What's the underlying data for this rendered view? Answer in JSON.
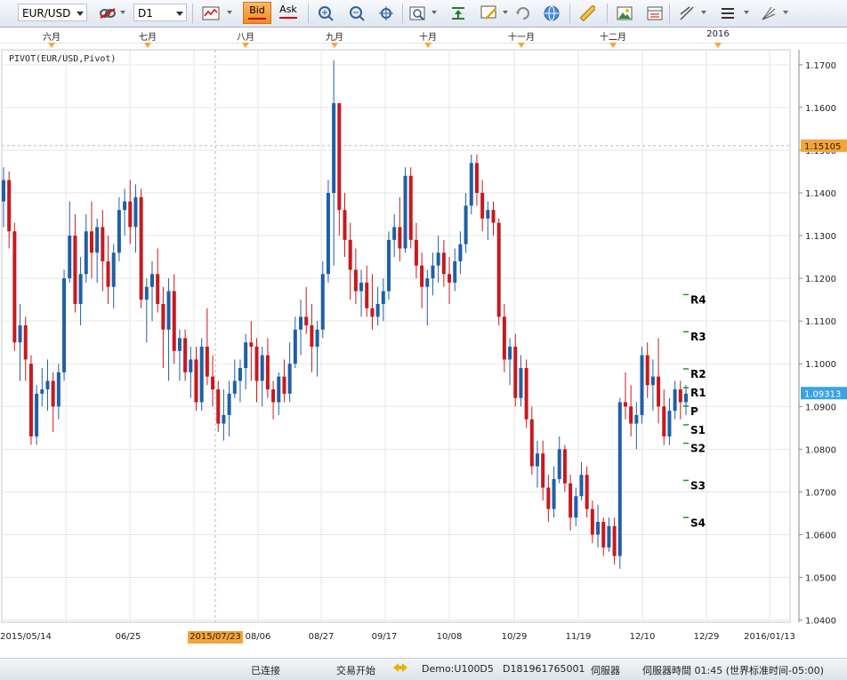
{
  "toolbar": {
    "symbol": "EUR/USD",
    "timeframe": "D1",
    "bid_label": "Bid",
    "ask_label": "Ask"
  },
  "indicator_label": "PIVOT(EUR/USD,Pivot)",
  "top_axis_months": [
    "六月",
    "七月",
    "八月",
    "九月",
    "十月",
    "十一月",
    "十二月",
    "2016"
  ],
  "bottom_axis_dates": [
    "2015/05/14",
    "06/25",
    "08/06",
    "08/27",
    "09/17",
    "10/08",
    "10/29",
    "11/19",
    "12/10",
    "12/29",
    "2016/01/13"
  ],
  "crosshair_date": "2015/07/23",
  "price_labels": [
    "1.1700",
    "1.1600",
    "1.1500",
    "1.1400",
    "1.1300",
    "1.1200",
    "1.1100",
    "1.1000",
    "1.0900",
    "1.0800",
    "1.0700",
    "1.0600",
    "1.0500",
    "1.0400"
  ],
  "crosshair_price": "1.15105",
  "current_price": "1.09313",
  "pivots": [
    {
      "label": "R4",
      "value": 1.1162
    },
    {
      "label": "R3",
      "value": 1.1075
    },
    {
      "label": "R2",
      "value": 1.0988
    },
    {
      "label": "R1",
      "value": 1.0944
    },
    {
      "label": "P",
      "value": 1.0901
    },
    {
      "label": "S1",
      "value": 1.0857
    },
    {
      "label": "S2",
      "value": 1.0814
    },
    {
      "label": "S3",
      "value": 1.0727
    },
    {
      "label": "S4",
      "value": 1.064
    }
  ],
  "status": {
    "connection": "已连接",
    "trading": "交易开始",
    "account": "Demo:U100D5",
    "login": "D181961765001",
    "server": "伺服器",
    "server_time": "伺服器時間 01:45 (世界标准时间-05:00)"
  },
  "colors": {
    "up": "#1f5fa8",
    "down": "#c8191e",
    "accent": "#f6a33a",
    "grid": "#e6e6e6"
  },
  "chart_data": {
    "type": "candlestick",
    "title": "",
    "yrange": [
      1.0395,
      1.1735
    ],
    "candles": [
      [
        1.138,
        1.146,
        1.132,
        1.143
      ],
      [
        1.143,
        1.145,
        1.127,
        1.131
      ],
      [
        1.131,
        1.133,
        1.103,
        1.105
      ],
      [
        1.105,
        1.114,
        1.096,
        1.109
      ],
      [
        1.109,
        1.111,
        1.096,
        1.101
      ],
      [
        1.1,
        1.102,
        1.081,
        1.083
      ],
      [
        1.083,
        1.095,
        1.081,
        1.093
      ],
      [
        1.093,
        1.099,
        1.09,
        1.094
      ],
      [
        1.094,
        1.101,
        1.089,
        1.096
      ],
      [
        1.096,
        1.098,
        1.084,
        1.09
      ],
      [
        1.09,
        1.1,
        1.087,
        1.098
      ],
      [
        1.098,
        1.122,
        1.096,
        1.12
      ],
      [
        1.12,
        1.138,
        1.119,
        1.13
      ],
      [
        1.13,
        1.135,
        1.112,
        1.114
      ],
      [
        1.114,
        1.125,
        1.109,
        1.121
      ],
      [
        1.121,
        1.135,
        1.119,
        1.131
      ],
      [
        1.131,
        1.138,
        1.12,
        1.126
      ],
      [
        1.126,
        1.134,
        1.119,
        1.132
      ],
      [
        1.132,
        1.136,
        1.117,
        1.124
      ],
      [
        1.124,
        1.13,
        1.114,
        1.118
      ],
      [
        1.118,
        1.128,
        1.113,
        1.126
      ],
      [
        1.126,
        1.139,
        1.124,
        1.136
      ],
      [
        1.136,
        1.141,
        1.13,
        1.138
      ],
      [
        1.138,
        1.143,
        1.128,
        1.132
      ],
      [
        1.132,
        1.142,
        1.126,
        1.139
      ],
      [
        1.139,
        1.141,
        1.113,
        1.115
      ],
      [
        1.115,
        1.12,
        1.105,
        1.118
      ],
      [
        1.118,
        1.124,
        1.11,
        1.121
      ],
      [
        1.121,
        1.127,
        1.112,
        1.114
      ],
      [
        1.114,
        1.118,
        1.099,
        1.108
      ],
      [
        1.108,
        1.12,
        1.096,
        1.117
      ],
      [
        1.117,
        1.121,
        1.1,
        1.103
      ],
      [
        1.103,
        1.108,
        1.096,
        1.106
      ],
      [
        1.106,
        1.108,
        1.096,
        1.098
      ],
      [
        1.098,
        1.104,
        1.092,
        1.101
      ],
      [
        1.101,
        1.104,
        1.089,
        1.091
      ],
      [
        1.091,
        1.106,
        1.089,
        1.104
      ],
      [
        1.104,
        1.113,
        1.095,
        1.097
      ],
      [
        1.097,
        1.102,
        1.09,
        1.094
      ],
      [
        1.094,
        1.096,
        1.084,
        1.086
      ],
      [
        1.086,
        1.094,
        1.082,
        1.088
      ],
      [
        1.088,
        1.096,
        1.083,
        1.093
      ],
      [
        1.093,
        1.101,
        1.092,
        1.096
      ],
      [
        1.096,
        1.101,
        1.091,
        1.099
      ],
      [
        1.099,
        1.107,
        1.094,
        1.105
      ],
      [
        1.105,
        1.11,
        1.096,
        1.104
      ],
      [
        1.104,
        1.106,
        1.091,
        1.096
      ],
      [
        1.096,
        1.104,
        1.09,
        1.102
      ],
      [
        1.102,
        1.106,
        1.092,
        1.094
      ],
      [
        1.094,
        1.096,
        1.087,
        1.091
      ],
      [
        1.091,
        1.098,
        1.088,
        1.097
      ],
      [
        1.097,
        1.101,
        1.091,
        1.093
      ],
      [
        1.093,
        1.105,
        1.091,
        1.1
      ],
      [
        1.1,
        1.111,
        1.099,
        1.108
      ],
      [
        1.108,
        1.115,
        1.102,
        1.111
      ],
      [
        1.111,
        1.118,
        1.107,
        1.109
      ],
      [
        1.109,
        1.114,
        1.098,
        1.104
      ],
      [
        1.104,
        1.11,
        1.097,
        1.108
      ],
      [
        1.108,
        1.124,
        1.106,
        1.121
      ],
      [
        1.121,
        1.143,
        1.119,
        1.14
      ],
      [
        1.14,
        1.171,
        1.123,
        1.161
      ],
      [
        1.161,
        1.158,
        1.13,
        1.136
      ],
      [
        1.136,
        1.14,
        1.125,
        1.129
      ],
      [
        1.129,
        1.133,
        1.115,
        1.122
      ],
      [
        1.122,
        1.127,
        1.114,
        1.117
      ],
      [
        1.117,
        1.122,
        1.111,
        1.119
      ],
      [
        1.119,
        1.123,
        1.111,
        1.113
      ],
      [
        1.113,
        1.121,
        1.108,
        1.111
      ],
      [
        1.111,
        1.118,
        1.109,
        1.114
      ],
      [
        1.114,
        1.12,
        1.11,
        1.117
      ],
      [
        1.117,
        1.131,
        1.115,
        1.129
      ],
      [
        1.129,
        1.135,
        1.125,
        1.132
      ],
      [
        1.132,
        1.139,
        1.124,
        1.127
      ],
      [
        1.127,
        1.146,
        1.126,
        1.144
      ],
      [
        1.144,
        1.146,
        1.127,
        1.129
      ],
      [
        1.129,
        1.133,
        1.12,
        1.123
      ],
      [
        1.123,
        1.126,
        1.113,
        1.118
      ],
      [
        1.118,
        1.122,
        1.109,
        1.12
      ],
      [
        1.12,
        1.126,
        1.116,
        1.123
      ],
      [
        1.123,
        1.13,
        1.119,
        1.126
      ],
      [
        1.126,
        1.129,
        1.118,
        1.121
      ],
      [
        1.121,
        1.125,
        1.114,
        1.119
      ],
      [
        1.119,
        1.127,
        1.117,
        1.124
      ],
      [
        1.124,
        1.131,
        1.121,
        1.128
      ],
      [
        1.128,
        1.14,
        1.126,
        1.137
      ],
      [
        1.137,
        1.149,
        1.135,
        1.147
      ],
      [
        1.147,
        1.149,
        1.137,
        1.14
      ],
      [
        1.14,
        1.143,
        1.131,
        1.134
      ],
      [
        1.134,
        1.138,
        1.129,
        1.136
      ],
      [
        1.136,
        1.138,
        1.13,
        1.133
      ],
      [
        1.133,
        1.134,
        1.109,
        1.111
      ],
      [
        1.111,
        1.114,
        1.098,
        1.101
      ],
      [
        1.101,
        1.106,
        1.095,
        1.104
      ],
      [
        1.104,
        1.107,
        1.09,
        1.092
      ],
      [
        1.092,
        1.102,
        1.09,
        1.099
      ],
      [
        1.099,
        1.101,
        1.085,
        1.087
      ],
      [
        1.087,
        1.09,
        1.074,
        1.076
      ],
      [
        1.076,
        1.082,
        1.071,
        1.079
      ],
      [
        1.079,
        1.082,
        1.068,
        1.071
      ],
      [
        1.071,
        1.074,
        1.063,
        1.066
      ],
      [
        1.066,
        1.076,
        1.064,
        1.073
      ],
      [
        1.073,
        1.083,
        1.072,
        1.08
      ],
      [
        1.08,
        1.081,
        1.07,
        1.072
      ],
      [
        1.072,
        1.074,
        1.061,
        1.064
      ],
      [
        1.064,
        1.071,
        1.062,
        1.069
      ],
      [
        1.069,
        1.077,
        1.068,
        1.074
      ],
      [
        1.074,
        1.076,
        1.064,
        1.066
      ],
      [
        1.066,
        1.068,
        1.058,
        1.06
      ],
      [
        1.06,
        1.067,
        1.057,
        1.063
      ],
      [
        1.063,
        1.064,
        1.055,
        1.057
      ],
      [
        1.057,
        1.064,
        1.056,
        1.062
      ],
      [
        1.062,
        1.064,
        1.053,
        1.055
      ],
      [
        1.055,
        1.092,
        1.052,
        1.091
      ],
      [
        1.091,
        1.098,
        1.087,
        1.09
      ],
      [
        1.09,
        1.095,
        1.083,
        1.086
      ],
      [
        1.086,
        1.091,
        1.08,
        1.088
      ],
      [
        1.088,
        1.104,
        1.086,
        1.102
      ],
      [
        1.102,
        1.105,
        1.092,
        1.095
      ],
      [
        1.095,
        1.101,
        1.089,
        1.097
      ],
      [
        1.097,
        1.106,
        1.086,
        1.09
      ],
      [
        1.09,
        1.094,
        1.081,
        1.083
      ],
      [
        1.083,
        1.092,
        1.081,
        1.089
      ],
      [
        1.089,
        1.096,
        1.087,
        1.094
      ],
      [
        1.094,
        1.096,
        1.087,
        1.091
      ],
      [
        1.091,
        1.095,
        1.088,
        1.093
      ]
    ]
  }
}
